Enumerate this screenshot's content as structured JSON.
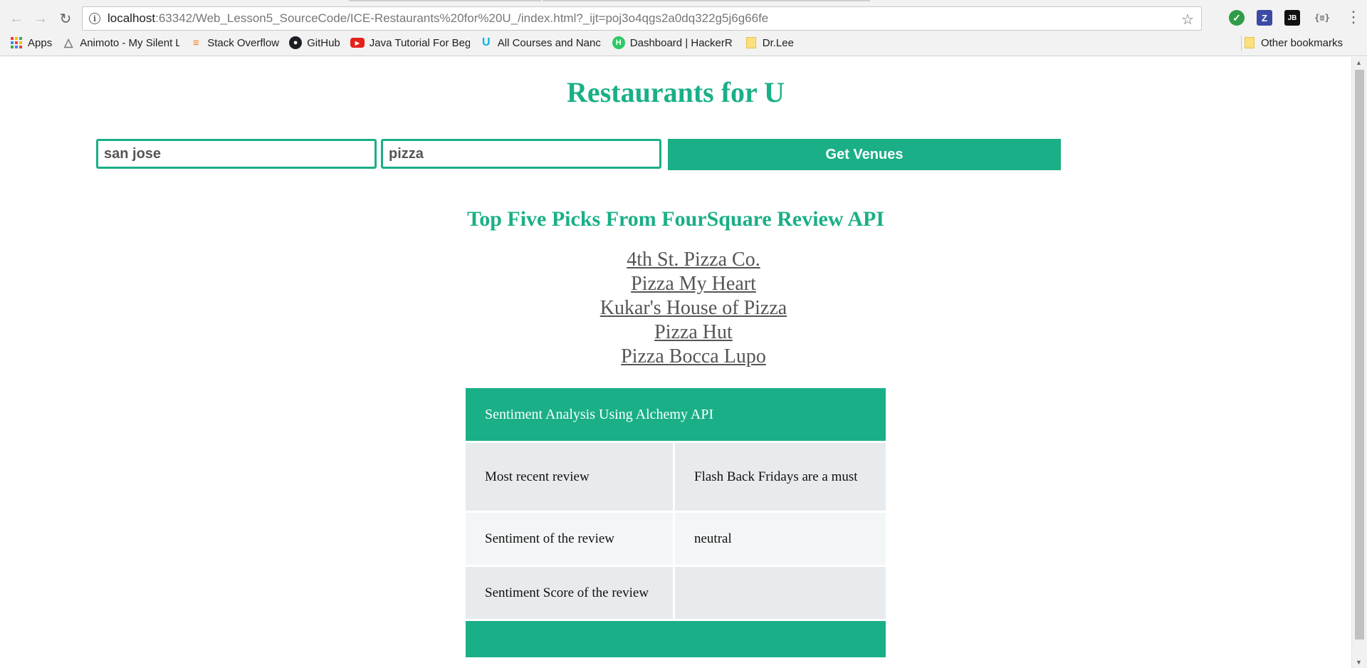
{
  "browser": {
    "url_host": "localhost",
    "url_rest": ":63342/Web_Lesson5_SourceCode/ICE-Restaurants%20for%20U_/index.html?_ijt=poj3o4qgs2a0dq322g5j6g66fe",
    "bookmarks": [
      {
        "label": "Apps",
        "icon": "apps-grid-icon"
      },
      {
        "label": "Animoto - My Silent L",
        "icon": "animoto-icon"
      },
      {
        "label": "Stack Overflow",
        "icon": "stackoverflow-icon"
      },
      {
        "label": "GitHub",
        "icon": "github-icon"
      },
      {
        "label": "Java Tutorial For Begi",
        "icon": "youtube-icon"
      },
      {
        "label": "All Courses and Nanc",
        "icon": "udacity-icon"
      },
      {
        "label": "Dashboard | HackerR",
        "icon": "hackerrank-icon"
      },
      {
        "label": "Dr.Lee",
        "icon": "folder-icon"
      }
    ],
    "other_bookmarks": "Other bookmarks",
    "extensions": {
      "z": "Z",
      "jb": "JB",
      "json": "{≡}"
    }
  },
  "page": {
    "title": "Restaurants for U",
    "search": {
      "city_value": "san jose",
      "query_value": "pizza",
      "button_label": "Get Venues"
    },
    "picks_title": "Top Five Picks From FourSquare Review API",
    "venues": [
      "4th St. Pizza Co.",
      "Pizza My Heart",
      "Kukar's House of Pizza",
      "Pizza Hut",
      "Pizza Bocca Lupo"
    ],
    "sentiment": {
      "header": "Sentiment Analysis Using Alchemy API",
      "rows": [
        {
          "label": "Most recent review",
          "value": "Flash Back Fridays are a must"
        },
        {
          "label": "Sentiment of the review",
          "value": "neutral"
        },
        {
          "label": "Sentiment Score of the review",
          "value": ""
        }
      ]
    }
  },
  "colors": {
    "accent": "#1aaf87",
    "link": "#555555",
    "row_dark": "#e7ebed",
    "row_light": "#f3f6f7"
  }
}
